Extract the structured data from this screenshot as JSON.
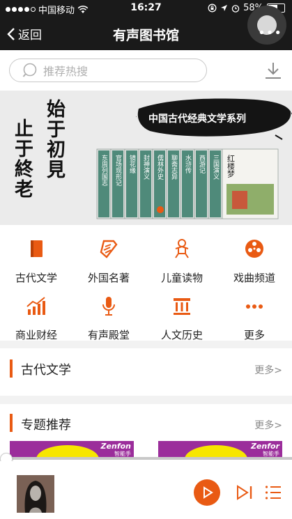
{
  "status_bar": {
    "carrier": "中国移动",
    "time": "16:27",
    "battery": "58%",
    "battery_level": 0.58
  },
  "nav": {
    "back_label": "返回",
    "title": "有声图书馆"
  },
  "search": {
    "placeholder": "推荐热搜"
  },
  "banner": {
    "calligraphy_right": "始于初見",
    "calligraphy_left": "止于終老",
    "series_title": "中国古代经典文学系列",
    "book_titles": [
      "东周列国志",
      "官场现形记",
      "镜花缘",
      "封神演义",
      "儒林外史",
      "聊斋志异",
      "水浒传",
      "西游记",
      "三国演义",
      "红楼梦"
    ]
  },
  "categories": [
    {
      "label": "古代文学",
      "icon": "book-icon"
    },
    {
      "label": "外国名著",
      "icon": "scroll-icon"
    },
    {
      "label": "儿童读物",
      "icon": "gingerbread-icon"
    },
    {
      "label": "戏曲频道",
      "icon": "film-reel-icon"
    },
    {
      "label": "商业财经",
      "icon": "chart-icon"
    },
    {
      "label": "有声殿堂",
      "icon": "microphone-icon"
    },
    {
      "label": "人文历史",
      "icon": "museum-icon"
    },
    {
      "label": "更多",
      "icon": "more-dots-icon"
    }
  ],
  "sections": [
    {
      "title": "古代文学",
      "more": "更多>"
    },
    {
      "title": "专题推荐",
      "more": "更多>"
    }
  ],
  "cards": [
    {
      "brand": "Zenfon",
      "sub": "智能手"
    },
    {
      "brand": "Zenfor",
      "sub": "智能手"
    }
  ],
  "colors": {
    "accent": "#e95a13",
    "topbar": "#1a1a1a",
    "card": "#9b2d9b",
    "card_yellow": "#f7e600"
  },
  "player": {
    "progress": 0
  }
}
